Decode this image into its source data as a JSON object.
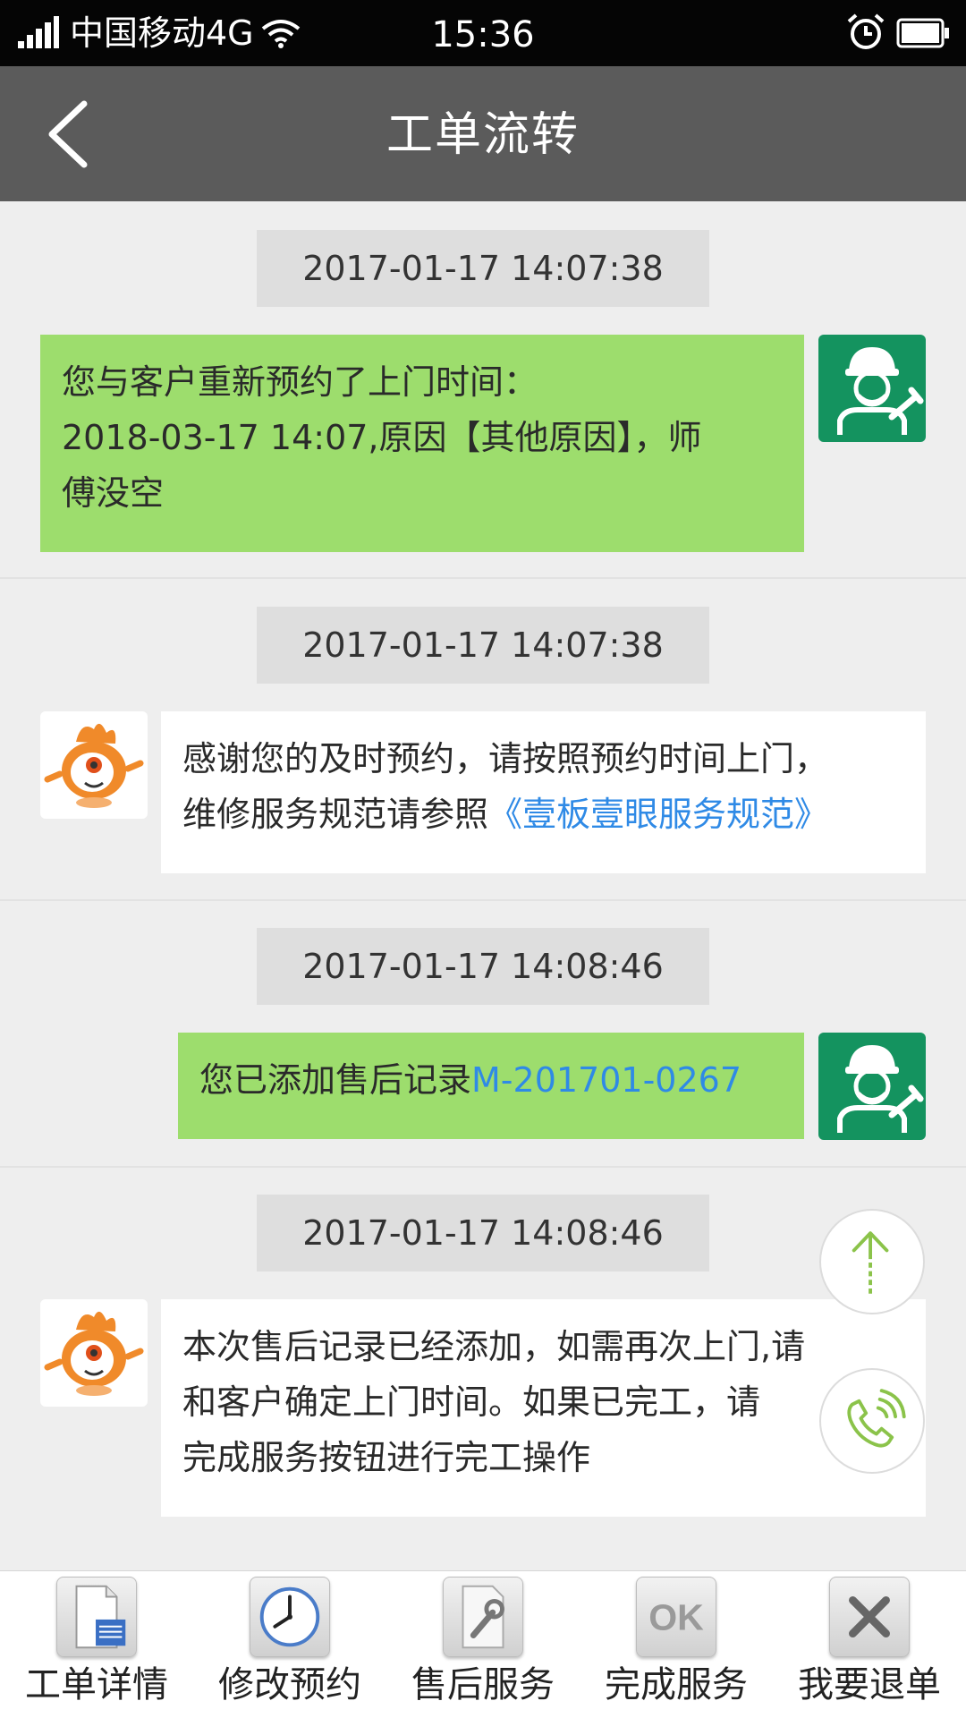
{
  "status_bar": {
    "carrier": "中国移动4G",
    "time": "15:36"
  },
  "nav": {
    "title": "工单流转"
  },
  "messages": [
    {
      "timestamp": "2017-01-17 14:07:38",
      "line1": "您与客户重新预约了上门时间：",
      "line2": "2018-03-17 14:07,原因【其他原因】，师",
      "line3": "傅没空"
    },
    {
      "timestamp": "2017-01-17 14:07:38",
      "line1": "感谢您的及时预约，请按照预约时间上门，",
      "line2_prefix": "维修服务规范请参照",
      "line2_link": "《壹板壹眼服务规范》"
    },
    {
      "timestamp": "2017-01-17 14:08:46",
      "text_prefix": "您已添加售后记录",
      "text_link": "M-201701-0267"
    },
    {
      "timestamp": "2017-01-17 14:08:46",
      "line1": "本次售后记录已经添加，如需再次上门,请",
      "line2": "和客户确定上门时间。如果已完工，请",
      "line3": "完成服务按钮进行完工操作"
    }
  ],
  "bottom_tabs": [
    {
      "label": "工单详情",
      "icon": "document-icon"
    },
    {
      "label": "修改预约",
      "icon": "clock-icon"
    },
    {
      "label": "售后服务",
      "icon": "wrench-icon"
    },
    {
      "label": "完成服务",
      "icon": "ok-icon",
      "icon_text": "OK"
    },
    {
      "label": "我要退单",
      "icon": "close-icon"
    }
  ],
  "colors": {
    "status_bar": "#050505",
    "nav_bar": "#5b5b5b",
    "background": "#eeeeee",
    "sent_bubble": "#9ddd6d",
    "received_bubble": "#ffffff",
    "link": "#2f8ae6",
    "worker_avatar": "#14935f",
    "fab_accent": "#8bc34a"
  }
}
